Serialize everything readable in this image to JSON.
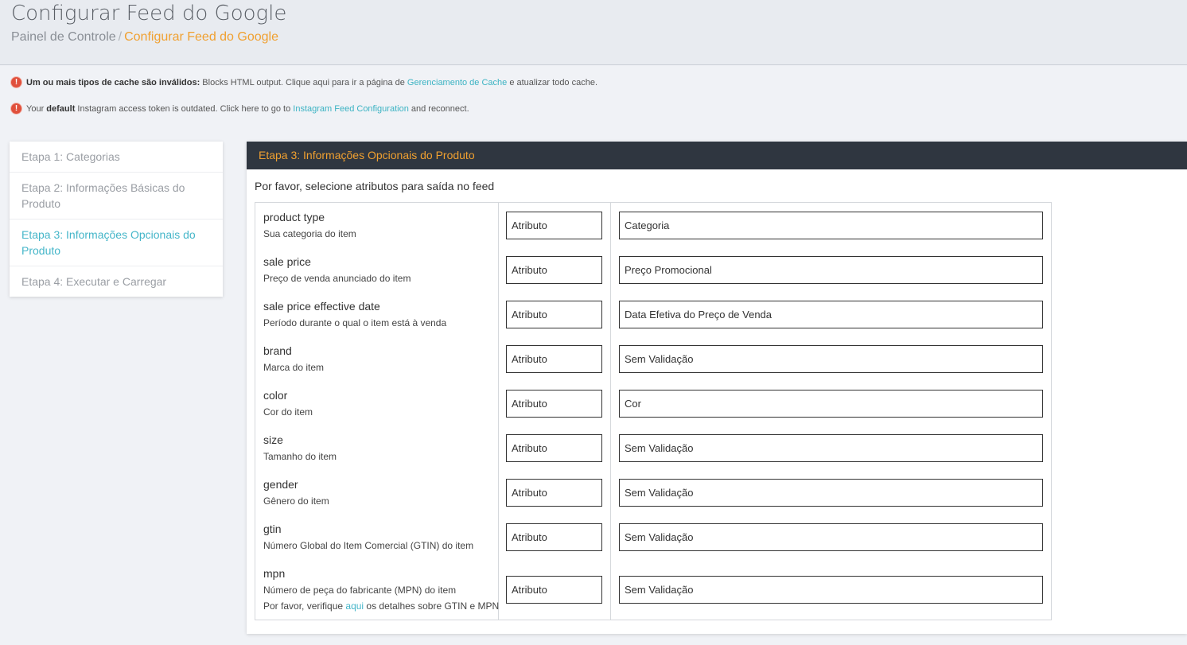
{
  "header": {
    "title": "Configurar Feed do Google",
    "breadcrumb_home": "Painel de Controle",
    "breadcrumb_sep": "/",
    "breadcrumb_current": "Configurar Feed do Google"
  },
  "alerts": [
    {
      "icon": "!",
      "bold": "Um ou mais tipos de cache são inválidos:",
      "text_before": " Blocks HTML output. Clique aqui para ir a página de ",
      "link": "Gerenciamento de Cache",
      "text_after": " e atualizar todo cache."
    },
    {
      "icon": "!",
      "prefix": "Your ",
      "bold": "default",
      "text_before": " Instagram access token is outdated. Click here to go to ",
      "link": "Instagram Feed Configuration",
      "text_after": " and reconnect."
    }
  ],
  "steps": [
    {
      "label": "Etapa 1: Categorias"
    },
    {
      "label": "Etapa 2: Informações Básicas do Produto"
    },
    {
      "label": "Etapa 3: Informações Opcionais do Produto"
    },
    {
      "label": "Etapa 4: Executar e Carregar"
    }
  ],
  "panel": {
    "title": "Etapa 3: Informações Opcionais do Produto",
    "intro": "Por favor, selecione atributos para saída no feed"
  },
  "fields": [
    {
      "name": "product type",
      "desc": "Sua categoria do item",
      "type": "Atributo",
      "value": "Categoria"
    },
    {
      "name": "sale price",
      "desc": "Preço de venda anunciado do item",
      "type": "Atributo",
      "value": "Preço Promocional"
    },
    {
      "name": "sale price effective date",
      "desc": "Período durante o qual o item está à venda",
      "type": "Atributo",
      "value": "Data Efetiva do Preço de Venda"
    },
    {
      "name": "brand",
      "desc": "Marca do item",
      "type": "Atributo",
      "value": "Sem Validação"
    },
    {
      "name": "color",
      "desc": "Cor do item",
      "type": "Atributo",
      "value": "Cor"
    },
    {
      "name": "size",
      "desc": "Tamanho do item",
      "type": "Atributo",
      "value": "Sem Validação"
    },
    {
      "name": "gender",
      "desc": "Gênero do item",
      "type": "Atributo",
      "value": "Sem Validação"
    },
    {
      "name": "gtin",
      "desc": "Número Global do Item Comercial (GTIN) do item",
      "type": "Atributo",
      "value": "Sem Validação"
    },
    {
      "name": "mpn",
      "desc": "Número de peça do fabricante (MPN) do item",
      "type": "Atributo",
      "value": "Sem Validação"
    }
  ],
  "mpn_note": {
    "before": "Por favor, verifique ",
    "link": "aqui",
    "after": " os detalhes sobre GTIN e MPN"
  },
  "colors": {
    "accent_orange": "#f0a030",
    "accent_teal": "#45b6c9",
    "panel_header": "#2f3640",
    "alert_icon": "#e0503c"
  }
}
